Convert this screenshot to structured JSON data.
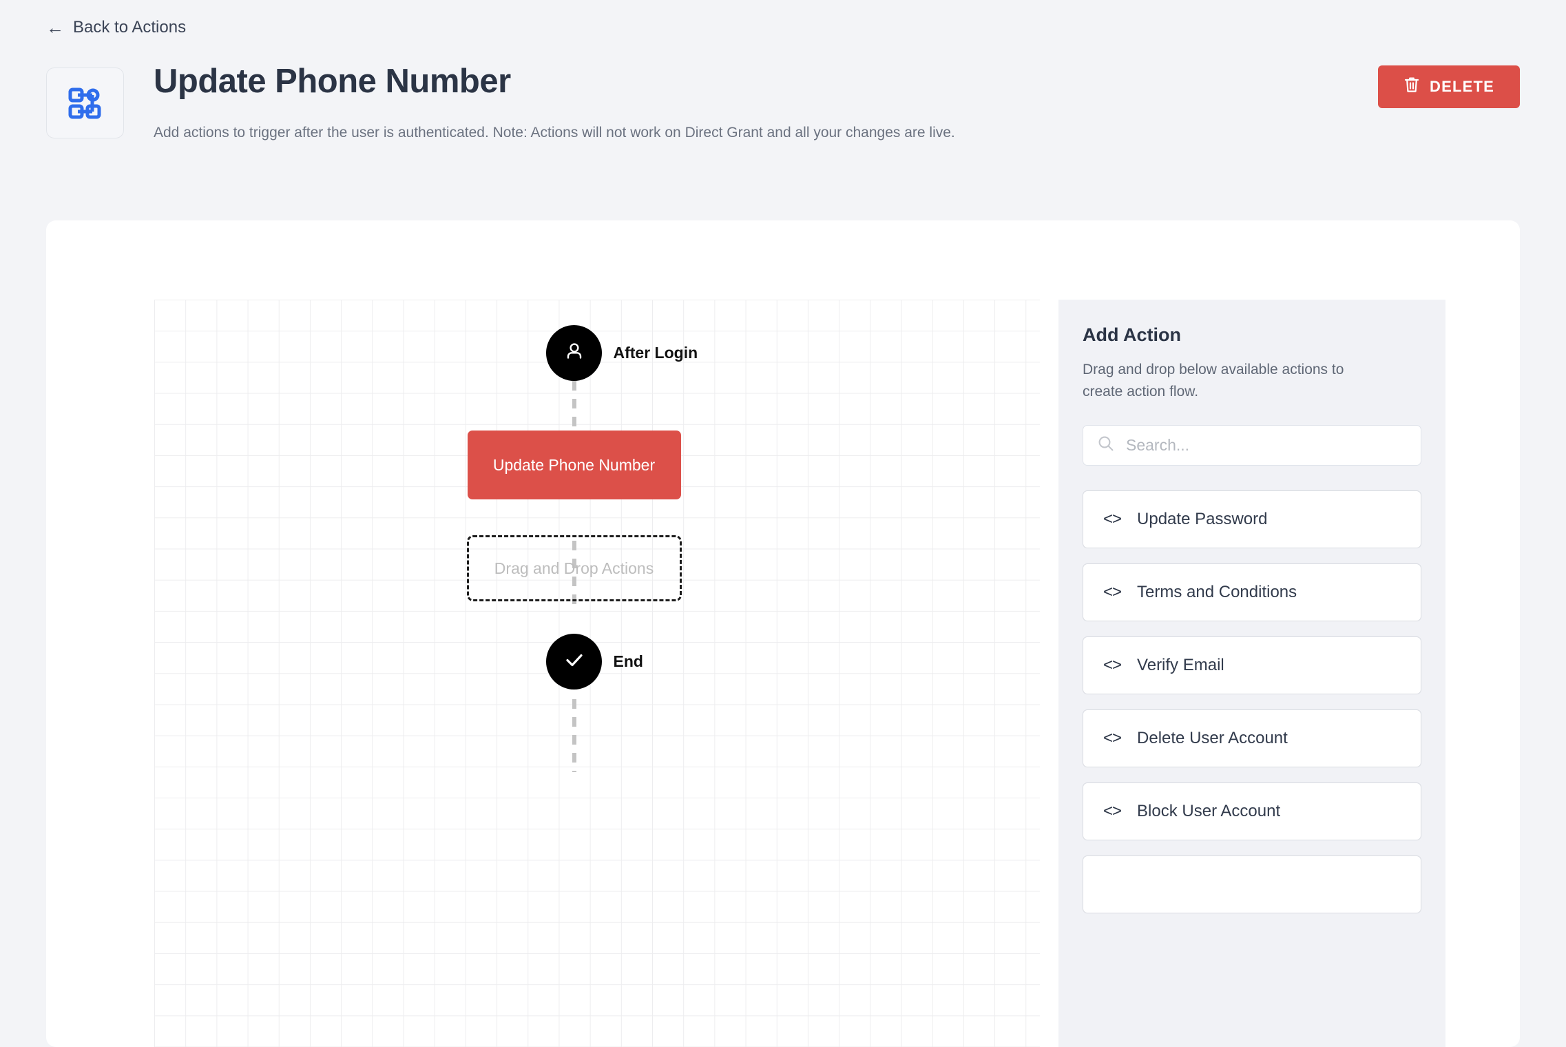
{
  "nav": {
    "back_label": "Back to Actions",
    "back_icon": "arrow-left-icon"
  },
  "header": {
    "icon": "flow-nodes-icon",
    "title": "Update Phone Number",
    "subtitle": "Add actions to trigger after the user is authenticated. Note: Actions will not work on Direct Grant and all your changes are live.",
    "delete_label": "DELETE",
    "delete_icon": "trash-icon",
    "delete_color": "#dc4f48"
  },
  "flow": {
    "start_node": {
      "label": "After Login",
      "icon": "user-icon",
      "color": "#000000"
    },
    "action_node": {
      "label": "Update Phone Number",
      "color": "#dc5049"
    },
    "drop_zone": {
      "label": "Drag and Drop Actions"
    },
    "end_node": {
      "label": "End",
      "icon": "check-icon",
      "color": "#000000"
    }
  },
  "panel": {
    "title": "Add Action",
    "description": "Drag and drop below available actions to create action flow.",
    "search": {
      "placeholder": "Search...",
      "value": "",
      "icon": "search-icon"
    },
    "actions": [
      {
        "label": "Update Password",
        "icon": "code-icon"
      },
      {
        "label": "Terms and Conditions",
        "icon": "code-icon"
      },
      {
        "label": "Verify Email",
        "icon": "code-icon"
      },
      {
        "label": "Delete User Account",
        "icon": "code-icon"
      },
      {
        "label": "Block User Account",
        "icon": "code-icon"
      },
      {
        "label": "",
        "icon": "code-icon"
      }
    ]
  }
}
